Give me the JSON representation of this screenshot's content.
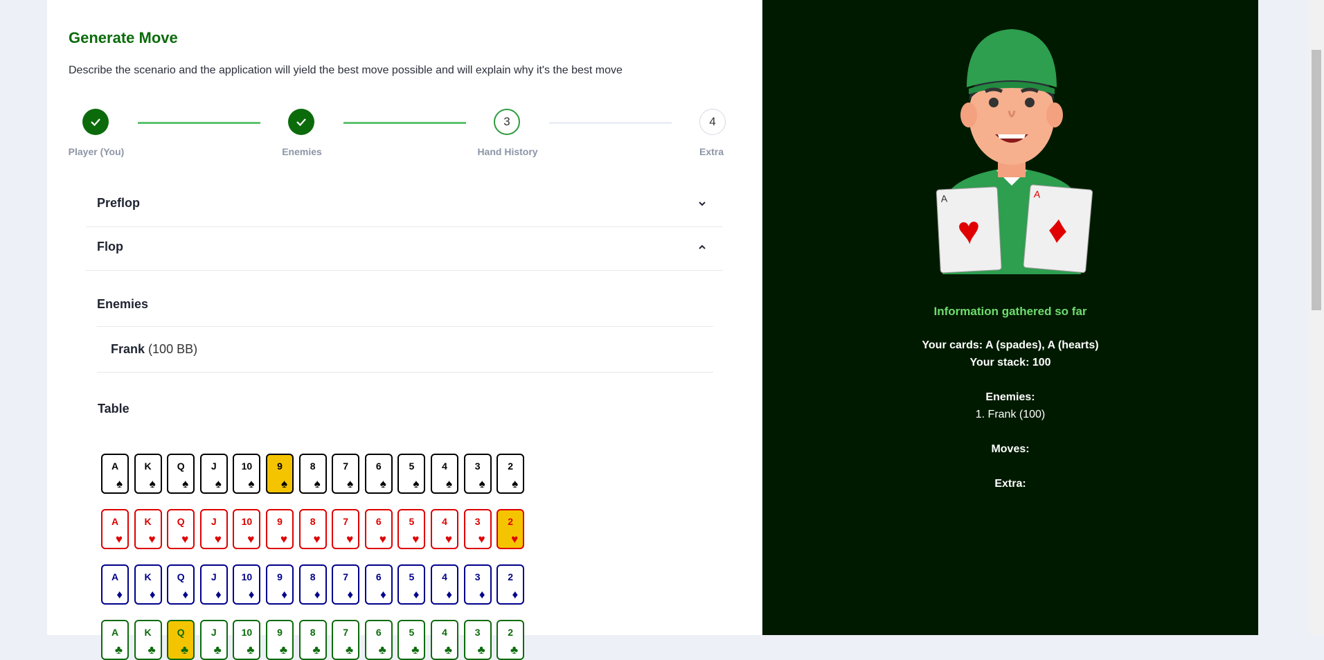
{
  "header": {
    "title": "Generate Move",
    "description": "Describe the scenario and the application will yield the best move possible and will explain why it's the best move"
  },
  "stepper": [
    {
      "label": "Player (You)",
      "state": "done",
      "number": ""
    },
    {
      "label": "Enemies",
      "state": "done",
      "number": ""
    },
    {
      "label": "Hand History",
      "state": "active",
      "number": "3"
    },
    {
      "label": "Extra",
      "state": "todo",
      "number": "4"
    }
  ],
  "accordion": {
    "preflop": "Preflop",
    "flop": "Flop"
  },
  "enemies_section": {
    "title": "Enemies",
    "enemy_name": "Frank",
    "enemy_stack": "(100 BB)"
  },
  "table_section": {
    "title": "Table"
  },
  "ranks": [
    "A",
    "K",
    "Q",
    "J",
    "10",
    "9",
    "8",
    "7",
    "6",
    "5",
    "4",
    "3",
    "2"
  ],
  "suit_rows": [
    {
      "suit": "spades",
      "glyph": "♠",
      "color": "#000000",
      "selected_rank": "9"
    },
    {
      "suit": "hearts",
      "glyph": "♥",
      "color": "#dd0000",
      "selected_rank": "2"
    },
    {
      "suit": "diamonds",
      "glyph": "♦",
      "color": "#00008b",
      "selected_rank": ""
    },
    {
      "suit": "clubs",
      "glyph": "♣",
      "color": "#0b6b0b",
      "selected_rank": "Q"
    }
  ],
  "info": {
    "title": "Information gathered so far",
    "your_cards": "Your cards: A (spades), A (hearts)",
    "your_stack": "Your stack: 100",
    "enemies_label": "Enemies:",
    "enemy_line": "1. Frank (100)",
    "moves_label": "Moves:",
    "extra_label": "Extra:"
  },
  "colors": {
    "accent_green": "#0b6b0b",
    "right_panel_bg": "#001a00",
    "info_title_green": "#6fdc6f",
    "selected_card": "#f5c400"
  },
  "mascot": {
    "left_card_rank": "A",
    "right_card_rank": "A"
  }
}
